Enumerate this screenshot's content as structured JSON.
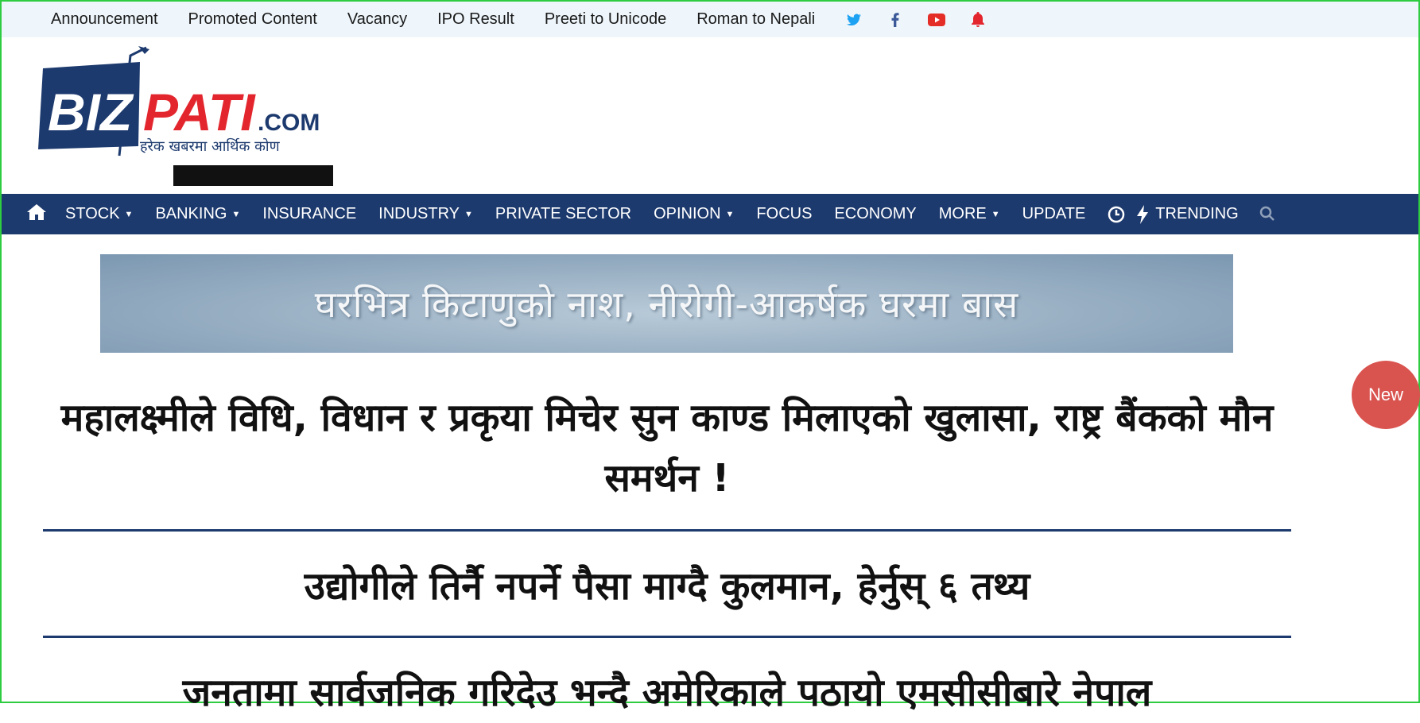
{
  "topbar": {
    "links": [
      "Announcement",
      "Promoted Content",
      "Vacancy",
      "IPO Result",
      "Preeti to Unicode",
      "Roman to Nepali"
    ],
    "social_icons": [
      "twitter-icon",
      "facebook-icon",
      "youtube-icon",
      "bell-icon"
    ]
  },
  "logo": {
    "brand_biz": "BIZ",
    "brand_pati": "PATI",
    "brand_com": ".COM",
    "tagline": "हरेक खबरमा आर्थिक कोण"
  },
  "nav": {
    "items": [
      {
        "label": "STOCK",
        "dropdown": true
      },
      {
        "label": "BANKING",
        "dropdown": true
      },
      {
        "label": "INSURANCE",
        "dropdown": false
      },
      {
        "label": "INDUSTRY",
        "dropdown": true
      },
      {
        "label": "PRIVATE SECTOR",
        "dropdown": false
      },
      {
        "label": "OPINION",
        "dropdown": true
      },
      {
        "label": "FOCUS",
        "dropdown": false
      },
      {
        "label": "ECONOMY",
        "dropdown": false
      },
      {
        "label": "MORE",
        "dropdown": true
      },
      {
        "label": "UPDATE",
        "dropdown": false
      }
    ],
    "trending_label": "TRENDING"
  },
  "banner": {
    "text": "घरभित्र किटाणुको नाश, नीरोगी-आकर्षक घरमा बास"
  },
  "headlines": [
    "महालक्ष्मीले विधि, विधान र प्रकृया मिचेर सुन काण्ड मिलाएको खुलासा, राष्ट्र बैंकको मौन समर्थन !",
    "उद्योगीले तिर्नै नपर्ने पैसा माग्दै कुलमान, हेर्नुस् ६ तथ्य",
    "जनतामा सार्वजनिक गरिदेउ भन्दै अमेरिकाले पठायो एमसीसीबारे नेपाल"
  ],
  "floating_button": "New",
  "colors": {
    "nav_bg": "#1d3a6e",
    "topbar_bg": "#eef6fb",
    "brand_blue": "#1d3a6e",
    "brand_red": "#e3262e",
    "new_badge": "#d9534f"
  }
}
